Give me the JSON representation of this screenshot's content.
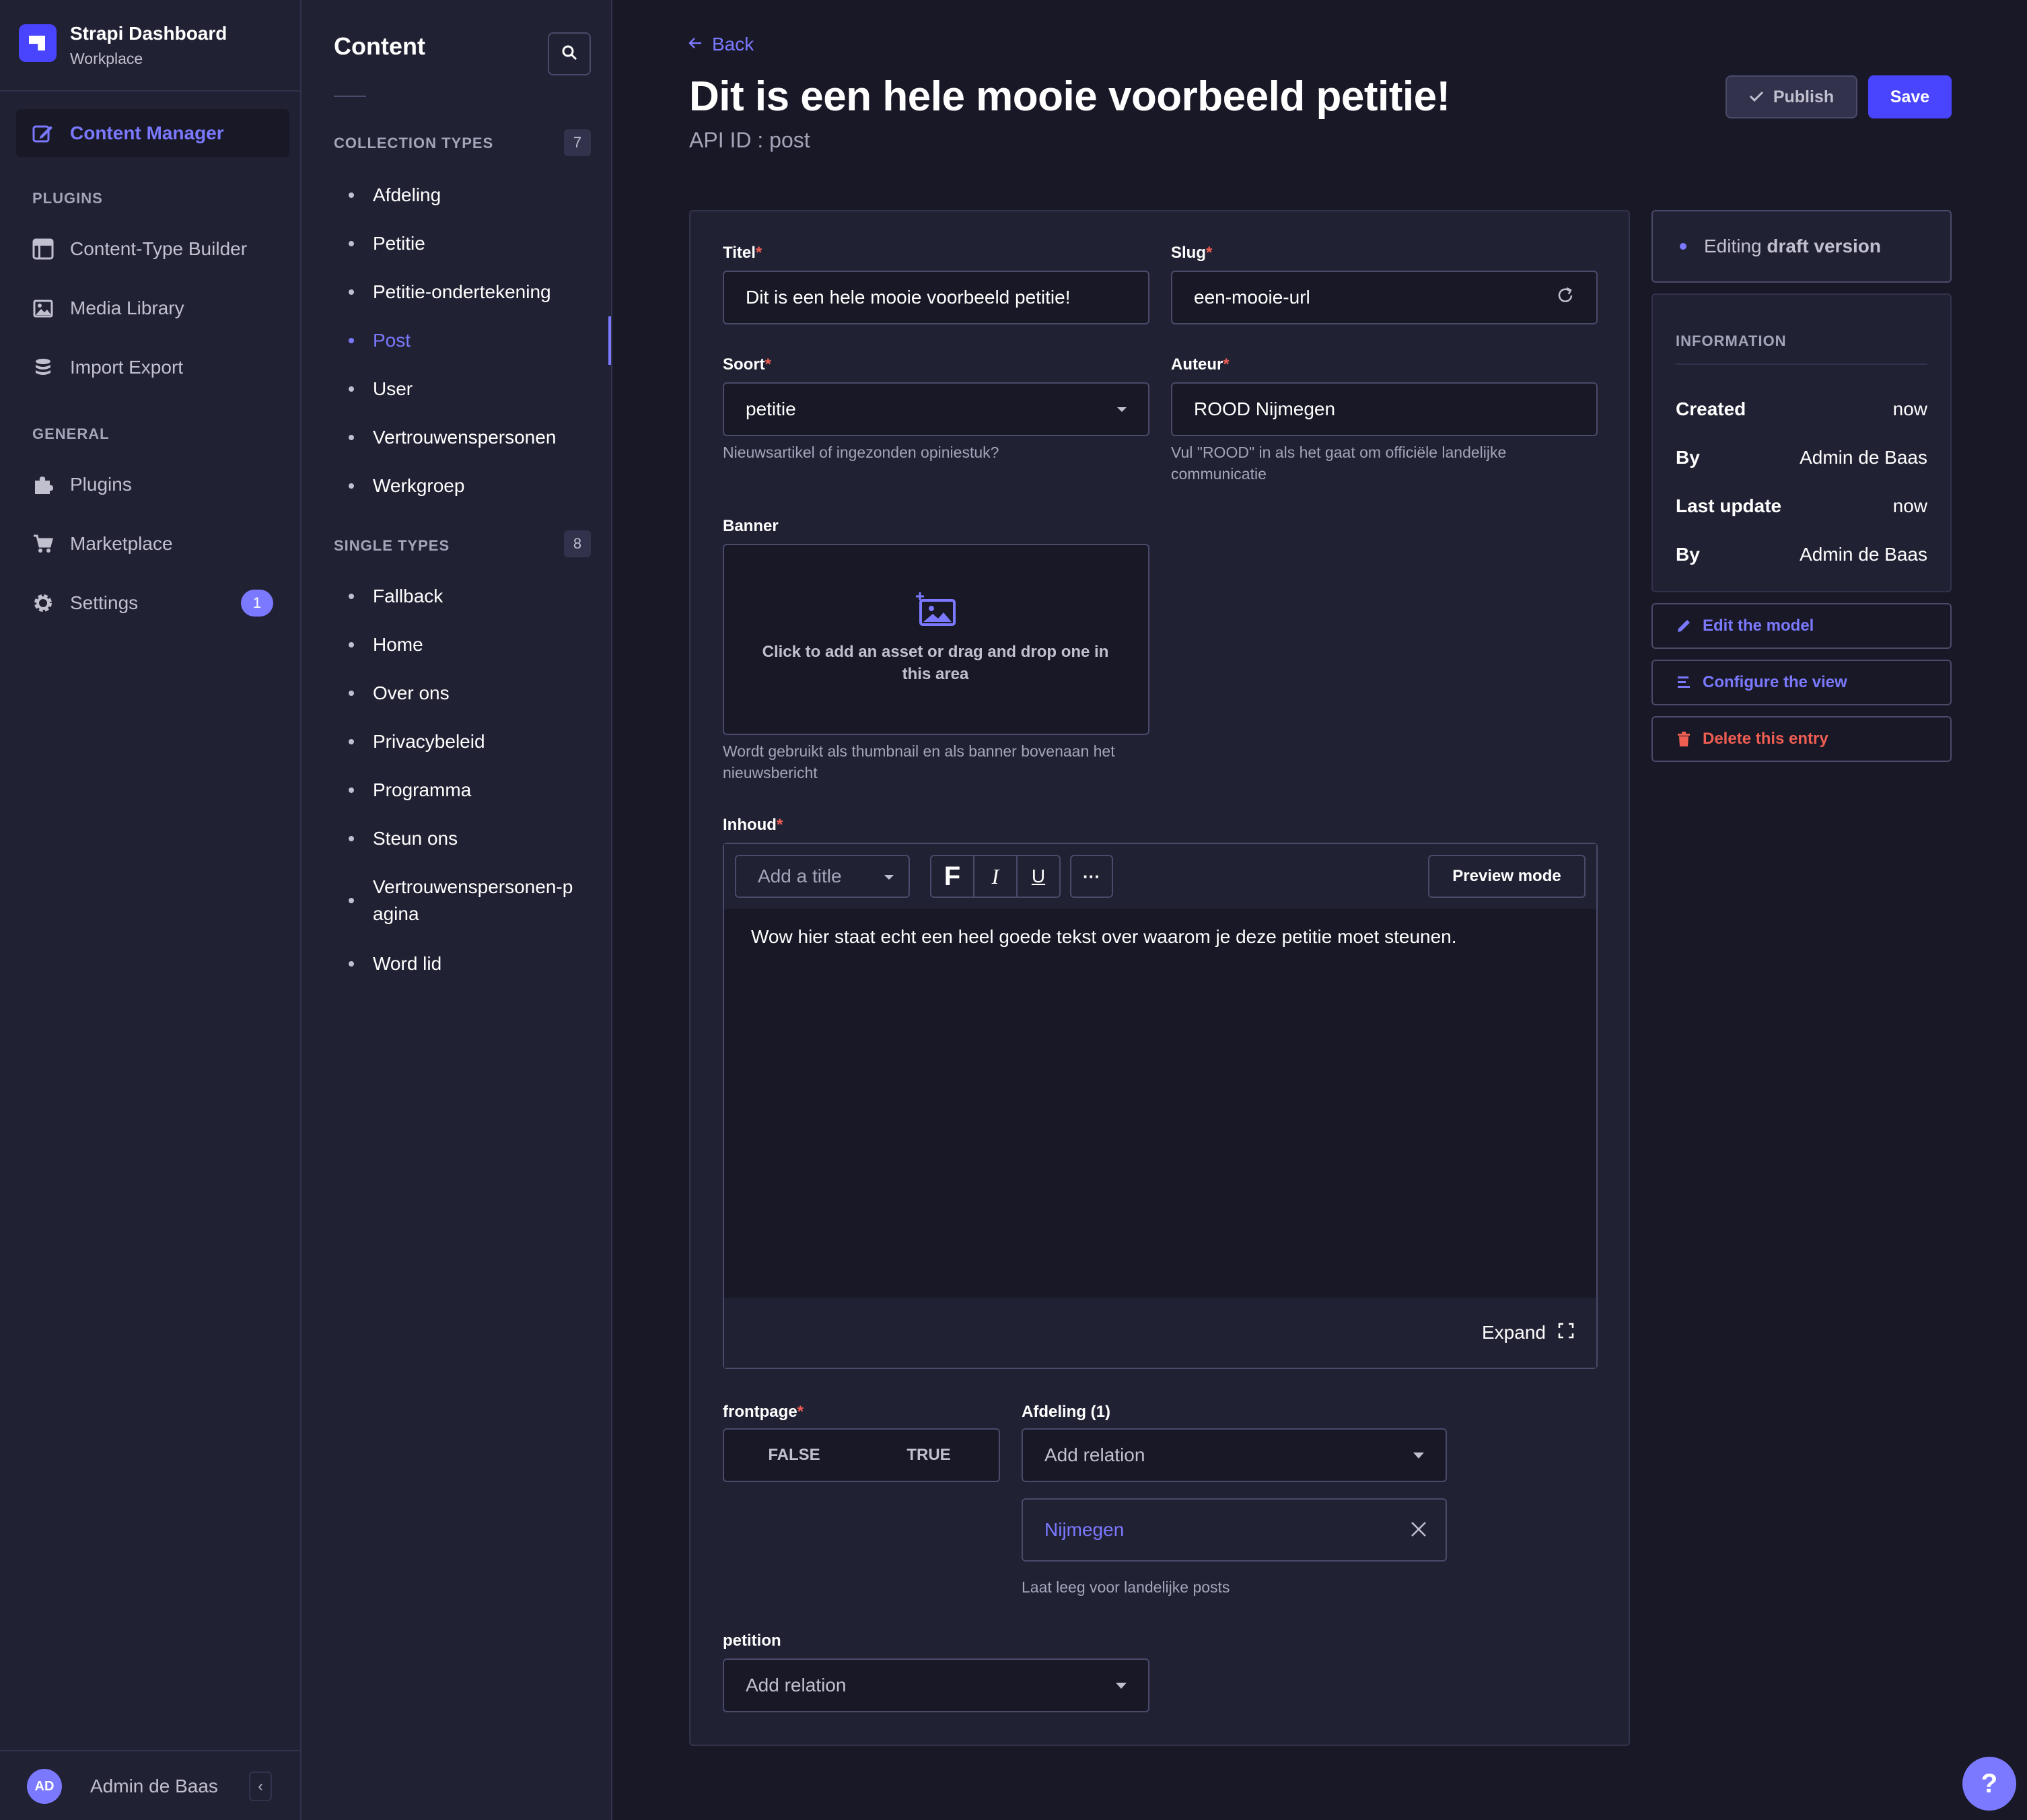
{
  "brand": {
    "title": "Strapi Dashboard",
    "subtitle": "Workplace"
  },
  "main_nav": {
    "content_manager": "Content Manager",
    "plugins_section": "PLUGINS",
    "plugins": [
      "Content-Type Builder",
      "Media Library",
      "Import Export"
    ],
    "general_section": "GENERAL",
    "general": [
      "Plugins",
      "Marketplace",
      "Settings"
    ],
    "settings_badge": "1"
  },
  "user": {
    "initials": "AD",
    "name": "Admin de Baas"
  },
  "sub_nav": {
    "title": "Content",
    "collection_label": "COLLECTION TYPES",
    "collection_count": "7",
    "collection_items": [
      "Afdeling",
      "Petitie",
      "Petitie-ondertekening",
      "Post",
      "User",
      "Vertrouwenspersonen",
      "Werkgroep"
    ],
    "single_label": "SINGLE TYPES",
    "single_count": "8",
    "single_items": [
      "Fallback",
      "Home",
      "Over ons",
      "Privacybeleid",
      "Programma",
      "Steun ons",
      "Vertrouwenspersonen-pagina",
      "Word lid"
    ],
    "active_item": "Post"
  },
  "header": {
    "back": "Back",
    "title": "Dit is een hele mooie voorbeeld petitie!",
    "api_id": "API ID : post",
    "publish": "Publish",
    "save": "Save"
  },
  "form": {
    "titel": {
      "label": "Titel",
      "value": "Dit is een hele mooie voorbeeld petitie!"
    },
    "slug": {
      "label": "Slug",
      "value": "een-mooie-url"
    },
    "soort": {
      "label": "Soort",
      "value": "petitie",
      "hint": "Nieuwsartikel of ingezonden opiniestuk?"
    },
    "auteur": {
      "label": "Auteur",
      "value": "ROOD Nijmegen",
      "hint": "Vul \"ROOD\" in als het gaat om officiële landelijke communicatie"
    },
    "banner": {
      "label": "Banner",
      "cta": "Click to add an asset or drag and drop one in this area",
      "hint": "Wordt gebruikt als thumbnail en als banner bovenaan het nieuwsbericht"
    },
    "inhoud": {
      "label": "Inhoud",
      "add_title": "Add a title",
      "preview": "Preview mode",
      "text": "Wow hier staat echt een heel goede tekst over waarom je deze petitie moet steunen.",
      "expand": "Expand"
    },
    "frontpage": {
      "label": "frontpage",
      "false": "FALSE",
      "true": "TRUE"
    },
    "afdeling": {
      "label": "Afdeling (1)",
      "placeholder": "Add relation",
      "relation": "Nijmegen",
      "hint": "Laat leeg voor landelijke posts"
    },
    "petition": {
      "label": "petition",
      "placeholder": "Add relation"
    }
  },
  "side_panel": {
    "draft_prefix": "Editing ",
    "draft_strong": "draft version",
    "info_title": "INFORMATION",
    "rows": [
      {
        "key": "Created",
        "value": "now"
      },
      {
        "key": "By",
        "value": "Admin de Baas"
      },
      {
        "key": "Last update",
        "value": "now"
      },
      {
        "key": "By",
        "value": "Admin de Baas"
      }
    ],
    "edit_model": "Edit the model",
    "configure_view": "Configure the view",
    "delete_entry": "Delete this entry"
  },
  "colors": {
    "primary": "#7b79ff",
    "primary_button": "#4945ff",
    "danger": "#ee5e52",
    "background": "#181826",
    "surface": "#212134"
  }
}
